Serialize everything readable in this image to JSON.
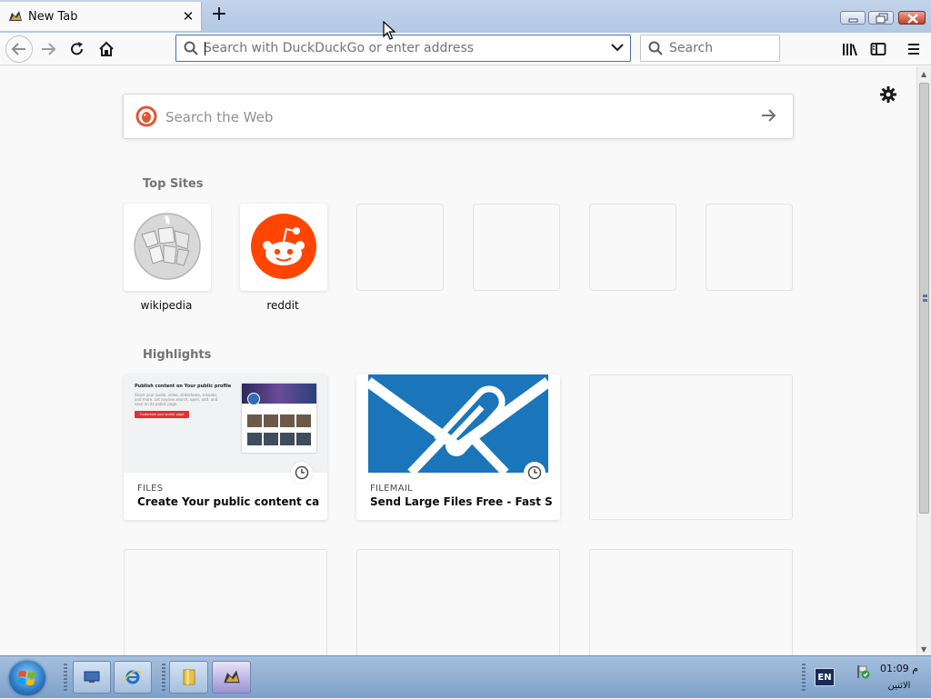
{
  "tab": {
    "title": "New Tab",
    "close": "✕",
    "new_tab": "+"
  },
  "toolbar": {
    "url_placeholder": "Search with DuckDuckGo or enter address",
    "search_placeholder": "Search"
  },
  "newtab": {
    "web_search_placeholder": "Search the Web",
    "top_sites_title": "Top Sites",
    "top_sites": [
      {
        "label": "wikipedia",
        "icon": "wikipedia-globe"
      },
      {
        "label": "reddit",
        "icon": "reddit-alien"
      },
      {
        "label": "",
        "empty": true
      },
      {
        "label": "",
        "empty": true
      },
      {
        "label": "",
        "empty": true
      },
      {
        "label": "",
        "empty": true
      }
    ],
    "highlights_title": "Highlights",
    "highlights": [
      {
        "source": "FILES",
        "title": "Create Your public content catal...",
        "thumb": {
          "heading": "Publish content on Your public profile",
          "body": "Share your audio, video, slideshows, e-books, and more. Let anyone search, open, add, and save on its public page.",
          "button": "Customize your public page"
        }
      },
      {
        "source": "FILEMAIL",
        "title": "Send Large Files Free - Fast Se..."
      }
    ]
  },
  "taskbar": {
    "lang": "EN",
    "time": "01:09 م",
    "date": "الاثنين"
  },
  "colors": {
    "accent": "#0a84ff",
    "reddit": "#ff4500",
    "filemail": "#1b75bb",
    "ddg": "#de5833"
  }
}
